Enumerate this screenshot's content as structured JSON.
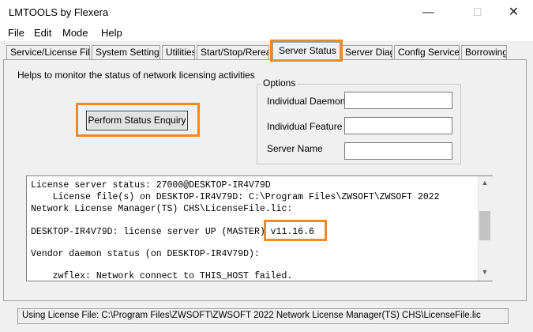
{
  "window": {
    "title": "LMTOOLS by Flexera",
    "minimize_glyph": "—",
    "maximize_glyph": "☐",
    "close_glyph": "✕"
  },
  "menu": [
    "File",
    "Edit",
    "Mode",
    "Help"
  ],
  "tabs": [
    {
      "label": "Service/License File"
    },
    {
      "label": "System Settings"
    },
    {
      "label": "Utilities"
    },
    {
      "label": "Start/Stop/Reread"
    },
    {
      "label": "Server Status",
      "active": true
    },
    {
      "label": "Server Diags"
    },
    {
      "label": "Config Services"
    },
    {
      "label": "Borrowing"
    }
  ],
  "server_status": {
    "help_text": "Helps to monitor the status of network licensing activities",
    "enquiry_button": "Perform Status Enquiry",
    "options": {
      "legend": "Options",
      "individual_daemon_label": "Individual Daemon",
      "individual_daemon_value": "",
      "individual_feature_label": "Individual Feature",
      "individual_feature_value": "",
      "server_name_label": "Server Name",
      "server_name_value": ""
    },
    "status_lines": [
      "License server status: 27000@DESKTOP-IR4V79D",
      "    License file(s) on DESKTOP-IR4V79D: C:\\Program Files\\ZWSOFT\\ZWSOFT 2022",
      "Network License Manager(TS) CHS\\LicenseFile.lic:",
      "",
      "DESKTOP-IR4V79D: license server UP (MASTER) v11.16.6",
      "",
      "Vendor daemon status (on DESKTOP-IR4V79D):",
      "",
      "    zwflex: Network connect to THIS_HOST failed."
    ]
  },
  "statusbar": {
    "text": "Using License File:  C:\\Program Files\\ZWSOFT\\ZWSOFT 2022 Network License Manager(TS) CHS\\LicenseFile.lic"
  },
  "colors": {
    "highlight": "#f08a24",
    "background": "#f0f0f0"
  }
}
